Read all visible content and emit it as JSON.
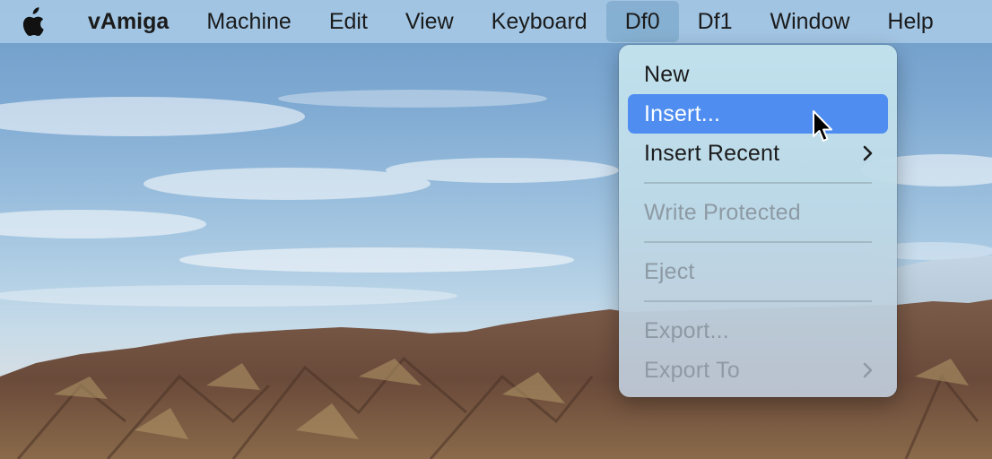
{
  "menubar": {
    "apple_icon": "apple-logo-icon",
    "app_name": "vAmiga",
    "items": [
      {
        "label": "Machine"
      },
      {
        "label": "Edit"
      },
      {
        "label": "View"
      },
      {
        "label": "Keyboard"
      },
      {
        "label": "Df0",
        "active": true
      },
      {
        "label": "Df1"
      },
      {
        "label": "Window"
      },
      {
        "label": "Help"
      }
    ]
  },
  "dropdown": {
    "new": "New",
    "insert": "Insert...",
    "insert_recent": "Insert Recent",
    "write_protected": "Write Protected",
    "eject": "Eject",
    "export": "Export...",
    "export_to": "Export To"
  },
  "colors": {
    "highlight": "#4f8ef0",
    "disabled_text": "#8d9aa4"
  }
}
